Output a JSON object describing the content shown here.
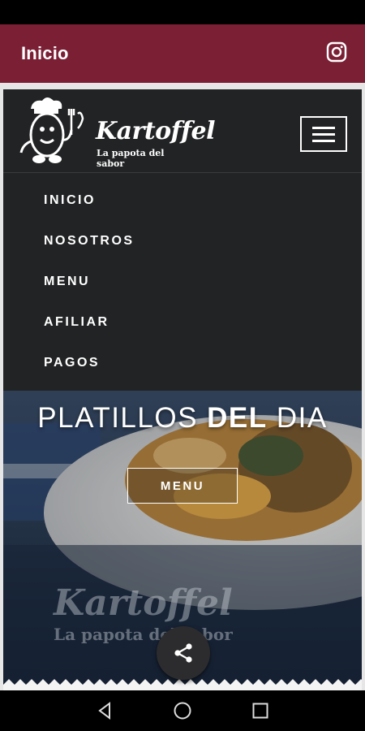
{
  "app_bar": {
    "title": "Inicio",
    "instagram_icon": "instagram-icon",
    "color": "#7b1f35"
  },
  "site": {
    "logo": {
      "name": "Kartoffel",
      "tagline": "La papota del sabor"
    },
    "menu_icon": "hamburger-icon",
    "nav": [
      {
        "label": "INICIO"
      },
      {
        "label": "NOSOTROS"
      },
      {
        "label": "MENU"
      },
      {
        "label": "AFILIAR"
      },
      {
        "label": "PAGOS"
      }
    ],
    "hero": {
      "title_part1": "PLATILLOS ",
      "title_bold": "DEL",
      "title_part2": " DIA",
      "button_label": "MENU",
      "watermark_name": "Kartoffel",
      "watermark_tagline": "La papota del sabor"
    }
  },
  "share_icon": "share-icon",
  "system_nav": {
    "back_icon": "back-icon",
    "home_icon": "home-icon",
    "recents_icon": "recents-icon"
  }
}
